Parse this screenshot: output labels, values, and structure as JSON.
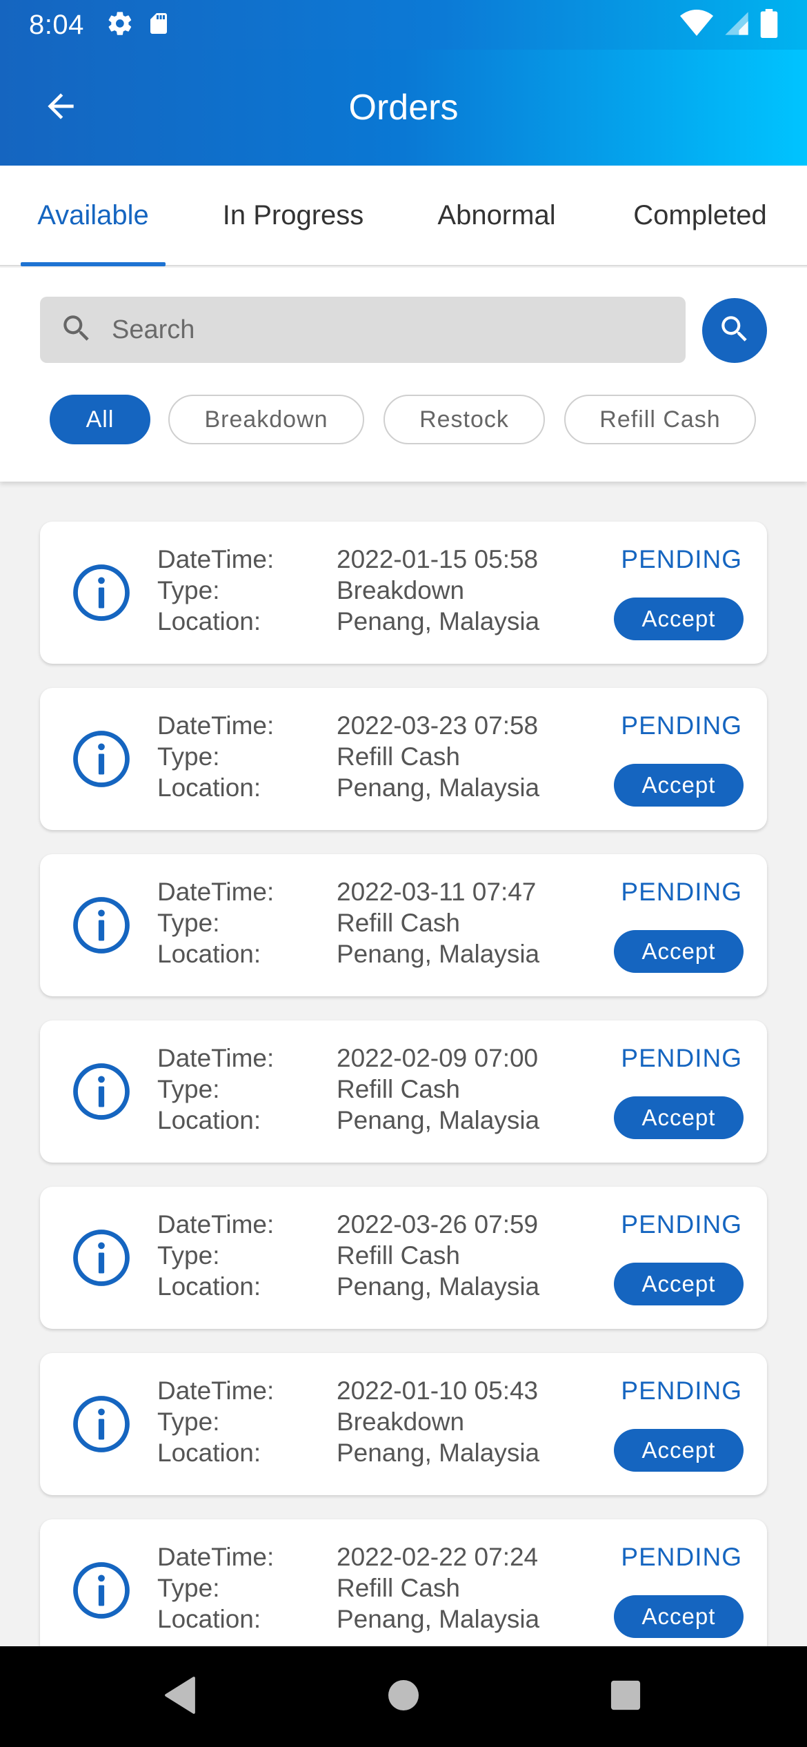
{
  "status_bar": {
    "time": "8:04",
    "icons_left": [
      "gear-icon",
      "sd-card-icon"
    ],
    "icons_right": [
      "wifi-icon",
      "signal-icon",
      "battery-icon"
    ]
  },
  "app_bar": {
    "title": "Orders",
    "back_icon": "arrow-left-icon",
    "gradient": [
      "#1565c0",
      "#00c4ff"
    ]
  },
  "tabs": [
    {
      "label": "Available",
      "active": true
    },
    {
      "label": "In Progress",
      "active": false
    },
    {
      "label": "Abnormal",
      "active": false
    },
    {
      "label": "Completed",
      "active": false
    }
  ],
  "search": {
    "placeholder": "Search",
    "value": ""
  },
  "filters": [
    {
      "label": "All",
      "active": true
    },
    {
      "label": "Breakdown",
      "active": false
    },
    {
      "label": "Restock",
      "active": false
    },
    {
      "label": "Refill Cash",
      "active": false
    }
  ],
  "field_labels": {
    "datetime": "DateTime:",
    "type": "Type:",
    "location": "Location:"
  },
  "orders": [
    {
      "datetime": "2022-01-15 05:58",
      "type": "Breakdown",
      "location": "Penang, Malaysia",
      "status": "PENDING",
      "action": "Accept"
    },
    {
      "datetime": "2022-03-23 07:58",
      "type": "Refill Cash",
      "location": "Penang, Malaysia",
      "status": "PENDING",
      "action": "Accept"
    },
    {
      "datetime": "2022-03-11 07:47",
      "type": "Refill Cash",
      "location": "Penang, Malaysia",
      "status": "PENDING",
      "action": "Accept"
    },
    {
      "datetime": "2022-02-09 07:00",
      "type": "Refill Cash",
      "location": "Penang, Malaysia",
      "status": "PENDING",
      "action": "Accept"
    },
    {
      "datetime": "2022-03-26 07:59",
      "type": "Refill Cash",
      "location": "Penang, Malaysia",
      "status": "PENDING",
      "action": "Accept"
    },
    {
      "datetime": "2022-01-10 05:43",
      "type": "Breakdown",
      "location": "Penang, Malaysia",
      "status": "PENDING",
      "action": "Accept"
    },
    {
      "datetime": "2022-02-22 07:24",
      "type": "Refill Cash",
      "location": "Penang, Malaysia",
      "status": "PENDING",
      "action": "Accept"
    }
  ],
  "colors": {
    "primary": "#1565c0",
    "accent_light": "#00c4ff",
    "background": "#f2f2f2"
  },
  "nav_bar": {
    "buttons": [
      "back-triangle-icon",
      "home-circle-icon",
      "recents-square-icon"
    ]
  }
}
